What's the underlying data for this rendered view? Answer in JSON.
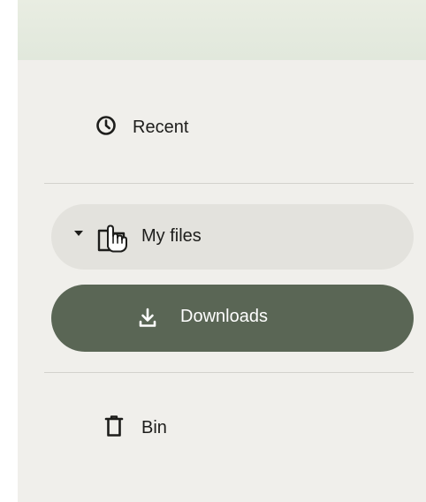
{
  "nav": {
    "recent": {
      "label": "Recent",
      "icon": "clock-icon"
    },
    "my_files": {
      "label": "My files",
      "icon": "folder-icon",
      "expanded": true
    },
    "downloads": {
      "label": "Downloads",
      "icon": "download-icon",
      "selected": true
    },
    "bin": {
      "label": "Bin",
      "icon": "trash-icon"
    }
  },
  "colors": {
    "panel_bg": "#f0efeb",
    "hover_bg": "#e3e2dd",
    "selected_bg": "#5a6655",
    "selected_text": "#ffffff",
    "text": "#1d1d1b"
  }
}
